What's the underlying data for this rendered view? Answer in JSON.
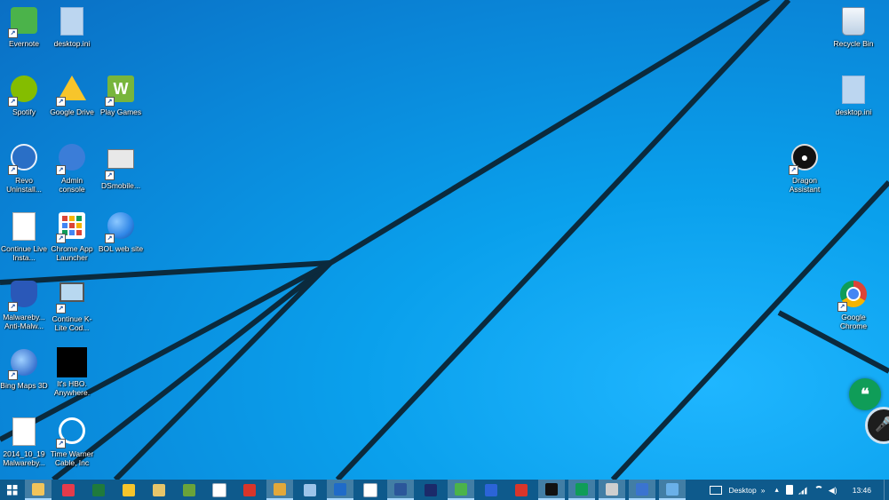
{
  "desktop_icons_left": [
    {
      "id": "evernote",
      "label": "Evernote",
      "icon": "evernote-icon",
      "color": "#4bb34a"
    },
    {
      "id": "desktop-ini-1",
      "label": "desktop.ini",
      "icon": "file-icon",
      "color": "#bcd6f0"
    },
    {
      "id": "spotify",
      "label": "Spotify",
      "icon": "spotify-icon",
      "color": "#84bd00"
    },
    {
      "id": "google-drive",
      "label": "Google Drive",
      "icon": "google-drive-icon",
      "color": "#f7c52b"
    },
    {
      "id": "play-games",
      "label": "Play Games",
      "icon": "play-games-icon",
      "color": "#78b53c"
    },
    {
      "id": "revo",
      "label": "Revo Uninstall...",
      "icon": "revo-icon",
      "color": "#2a6fc6"
    },
    {
      "id": "admin-console",
      "label": "Admin console",
      "icon": "admin-console-icon",
      "color": "#3b7dd8"
    },
    {
      "id": "dsmobile",
      "label": "DSmobile...",
      "icon": "scanner-icon",
      "color": "#e8e8e8"
    },
    {
      "id": "continue-live",
      "label": "Continue Live Insta...",
      "icon": "document-icon",
      "color": "#ffffff"
    },
    {
      "id": "chrome-app-launcher",
      "label": "Chrome App Launcher",
      "icon": "app-launcher-icon",
      "color": "#ffffff"
    },
    {
      "id": "bol-web",
      "label": "BOL web site",
      "icon": "globe-icon",
      "color": "#2f86e6"
    },
    {
      "id": "malwarebytes",
      "label": "Malwareby... Anti-Malw...",
      "icon": "malwarebytes-icon",
      "color": "#2a58b8"
    },
    {
      "id": "continue-klite",
      "label": "Continue K-Lite Cod...",
      "icon": "installer-icon",
      "color": "#6bbf4a"
    },
    {
      "id": "bing-maps",
      "label": "Bing Maps 3D",
      "icon": "bing-maps-icon",
      "color": "#3a74d0"
    },
    {
      "id": "hbo",
      "label": "It's HBO. Anywhere.",
      "icon": "hbo-icon",
      "color": "#000000"
    },
    {
      "id": "malwarebytes-log",
      "label": "2014_10_19 Malwareby...",
      "icon": "text-file-icon",
      "color": "#ffffff"
    },
    {
      "id": "time-warner",
      "label": "Time Warner Cable, Inc",
      "icon": "time-warner-icon",
      "color": "#ffffff"
    }
  ],
  "desktop_icons_right": [
    {
      "id": "recycle-bin",
      "label": "Recycle Bin",
      "icon": "recycle-bin-icon"
    },
    {
      "id": "desktop-ini-2",
      "label": "desktop.ini",
      "icon": "file-icon"
    },
    {
      "id": "dragon",
      "label": "Dragon Assistant",
      "icon": "microphone-icon"
    },
    {
      "id": "google-chrome",
      "label": "Google Chrome",
      "icon": "chrome-icon"
    }
  ],
  "taskbar": {
    "start_icon": "windows-logo-icon",
    "buttons": [
      {
        "name": "file-explorer",
        "icon": "folder-icon",
        "color": "#f2c45a",
        "active": true
      },
      {
        "name": "pocket",
        "icon": "pocket-icon",
        "color": "#e53b4b",
        "active": false
      },
      {
        "name": "excel",
        "icon": "excel-icon",
        "color": "#1f7a3c",
        "active": false
      },
      {
        "name": "google-drive",
        "icon": "drive-icon",
        "color": "#f7c52b",
        "active": false
      },
      {
        "name": "folder-yellow",
        "icon": "folder-icon",
        "color": "#e6c56a",
        "active": false
      },
      {
        "name": "play-games",
        "icon": "play-games-icon",
        "color": "#6aa33a",
        "active": false
      },
      {
        "name": "app-launcher",
        "icon": "grid-icon",
        "color": "#ffffff",
        "active": false
      },
      {
        "name": "media",
        "icon": "media-icon",
        "color": "#d9352a",
        "active": false
      },
      {
        "name": "chrome",
        "icon": "chrome-icon",
        "color": "#e2a83a",
        "active": true
      },
      {
        "name": "network",
        "icon": "network-icon",
        "color": "#9cc4ea",
        "active": false
      },
      {
        "name": "outlook",
        "icon": "outlook-icon",
        "color": "#1f6bc8",
        "active": true
      },
      {
        "name": "document",
        "icon": "document-icon",
        "color": "#ffffff",
        "active": false
      },
      {
        "name": "word",
        "icon": "word-icon",
        "color": "#2b579a",
        "active": true
      },
      {
        "name": "app-dark",
        "icon": "app-icon",
        "color": "#1b2a6a",
        "active": false
      },
      {
        "name": "evernote",
        "icon": "evernote-icon",
        "color": "#4bb34a",
        "active": true
      },
      {
        "name": "app-blue",
        "icon": "app-icon",
        "color": "#2b64d8",
        "active": false
      },
      {
        "name": "toolbox",
        "icon": "toolbox-icon",
        "color": "#d9352a",
        "active": false
      },
      {
        "name": "app-black",
        "icon": "app-icon",
        "color": "#111111",
        "active": true
      },
      {
        "name": "hangouts",
        "icon": "hangouts-icon",
        "color": "#0f9d58",
        "active": true
      },
      {
        "name": "scanner",
        "icon": "scanner-icon",
        "color": "#cfcfcf",
        "active": true
      },
      {
        "name": "help",
        "icon": "help-icon",
        "color": "#3a74d0",
        "active": true
      },
      {
        "name": "remote",
        "icon": "remote-desktop-icon",
        "color": "#6ab0e8",
        "active": true
      }
    ]
  },
  "tray": {
    "keyboard_icon": "keyboard-icon",
    "desktop_label": "Desktop",
    "more": "»",
    "chevron": "▴",
    "clock": "13:46"
  },
  "floaters": [
    {
      "name": "hangouts-floater",
      "icon": "hangouts-icon",
      "color": "#0f9d58"
    },
    {
      "name": "dragon-floater",
      "icon": "microphone-icon",
      "color": "#1d1d1d"
    }
  ]
}
